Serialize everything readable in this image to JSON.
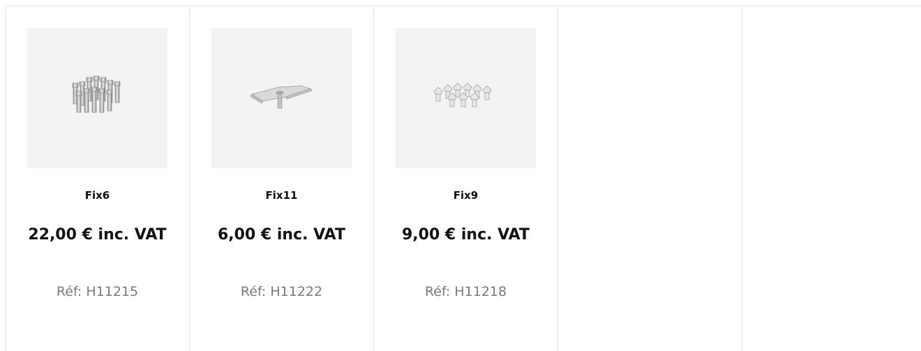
{
  "products": [
    {
      "name": "Fix6",
      "price": "22,00 € inc. VAT",
      "ref": "Réf: H11215",
      "icon": "pins-cluster-icon"
    },
    {
      "name": "Fix11",
      "price": "6,00 € inc. VAT",
      "ref": "Réf: H11222",
      "icon": "bracket-screw-icon"
    },
    {
      "name": "Fix9",
      "price": "9,00 € inc. VAT",
      "ref": "Réf: H11218",
      "icon": "studs-cluster-icon"
    }
  ],
  "colors": {
    "border": "#e2e2e2",
    "thumb_bg": "#f3f3f3",
    "text": "#111111",
    "muted": "#7a7a7a"
  }
}
